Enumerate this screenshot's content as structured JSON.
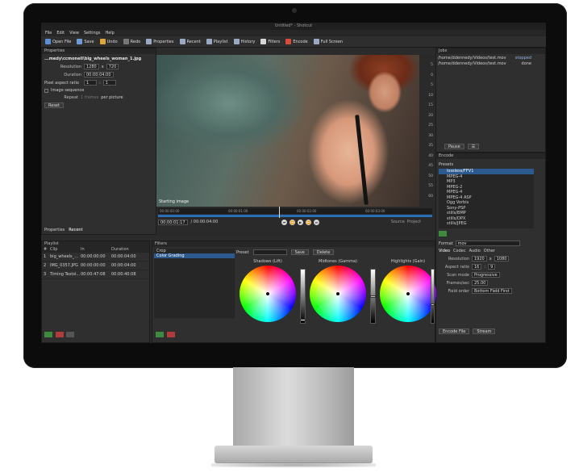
{
  "window": {
    "title": "Untitled* - Shotcut"
  },
  "menu": [
    "File",
    "Edit",
    "View",
    "Settings",
    "Help"
  ],
  "toolbar": [
    {
      "label": "Open File",
      "icon": "open-file-icon",
      "color": "#5a8fd6"
    },
    {
      "label": "Save",
      "icon": "save-icon",
      "color": "#6d9bd8"
    },
    {
      "label": "Undo",
      "icon": "undo-icon",
      "color": "#e0a43a"
    },
    {
      "label": "Redo",
      "icon": "redo-icon",
      "color": "#777777"
    },
    {
      "label": "Properties",
      "icon": "properties-icon",
      "color": "#9aa9c2"
    },
    {
      "label": "Recent",
      "icon": "recent-icon",
      "color": "#9aa9c2"
    },
    {
      "label": "Playlist",
      "icon": "playlist-icon",
      "color": "#9aa9c2"
    },
    {
      "label": "History",
      "icon": "history-icon",
      "color": "#9aa9c2"
    },
    {
      "label": "Filters",
      "icon": "filters-icon",
      "color": "#d7d7d7"
    },
    {
      "label": "Encode",
      "icon": "encode-icon",
      "color": "#d94b3b"
    },
    {
      "label": "Full Screen",
      "icon": "full-screen-icon",
      "color": "#9aa9c2"
    }
  ],
  "properties": {
    "title": "Properties",
    "file": "...medy\\ccmonell\\big_wheels_woman_1.jpg",
    "resolution_label": "Resolution",
    "res_w": "1280",
    "res_x": "x",
    "res_h": "720",
    "duration_label": "Duration",
    "duration": "00:00:04:00",
    "pixel_aspect_label": "Pixel aspect ratio",
    "pa_num": "1",
    "pa_colon": ":",
    "pa_den": "1",
    "image_sequence_label": "Image sequence",
    "repeat_label": "Repeat",
    "repeat_value": "1 frames",
    "per_picture": "per picture",
    "reset": "Reset",
    "tabs": [
      "Properties",
      "Recent"
    ]
  },
  "viewer": {
    "caption": "Starting image"
  },
  "ruler_marks": [
    "5",
    "0",
    "5",
    "10",
    "15",
    "20",
    "25",
    "30",
    "35",
    "40",
    "45",
    "50",
    "55",
    "60"
  ],
  "timeline": {
    "ticks": [
      "00:00:00:00",
      "00:00:01:00",
      "00:00:02:00",
      "00:00:03:00"
    ],
    "current": "00:00:01:17",
    "total": "/ 00:00:04:00",
    "zoom": "",
    "transport": [
      "⏮",
      "⏪",
      "▶",
      "⏩",
      "⏭"
    ],
    "playhead_fraction": 0.44,
    "source_tab": "Source",
    "project_tab": "Project"
  },
  "jobs": {
    "title": "Jobs",
    "rows": [
      {
        "file": "/home/ddennedy/Videos/test.mov",
        "status": "stopped"
      },
      {
        "file": "/home/ddennedy/Videos/test.mov",
        "status": "done"
      }
    ],
    "pause": "Pause",
    "menu": "☰"
  },
  "encode": {
    "title": "Encode",
    "presets_label": "Presets",
    "presets": [
      "lossless/FFV1",
      "MPEG-4",
      "MP3",
      "MPEG-2",
      "MPEG-4",
      "MPEG-4 ASP",
      "Ogg Vorbis",
      "Sony-PSP",
      "stills/BMP",
      "stills/DPX",
      "stills/JPEG"
    ],
    "format_label": "Format",
    "format_value": "mov",
    "tabs": [
      "Video",
      "Codec",
      "Audio",
      "Other"
    ],
    "resolution_label": "Resolution",
    "res_w": "1920",
    "res_x": "x",
    "res_h": "1080",
    "aspect_label": "Aspect ratio",
    "aspect_w": "16",
    "aspect_colon": ":",
    "aspect_h": "9",
    "scan_label": "Scan mode",
    "scan_value": "Progressive",
    "fps_label": "Frames/sec",
    "fps_value": "25.00",
    "field_label": "Field order",
    "field_value": "Bottom Field First",
    "encode_btn": "Encode File",
    "stream_btn": "Stream"
  },
  "playlist": {
    "title": "Playlist",
    "columns": [
      "#",
      "Clip",
      "In",
      "Duration"
    ],
    "rows": [
      {
        "n": "1",
        "clip": "big_wheels_...",
        "in": "00:00:00:00",
        "dur": "00:00:04:00"
      },
      {
        "n": "2",
        "clip": "IMG_0357.JPG",
        "in": "00:00:00:00",
        "dur": "00:00:04:00"
      },
      {
        "n": "3",
        "clip": "Timing Testsl...",
        "in": "00:00:47:08",
        "dur": "00:00:40:08"
      }
    ]
  },
  "filters": {
    "title": "Filters",
    "items": [
      "Crop",
      "Color Grading"
    ],
    "preset_label": "Preset",
    "save": "Save",
    "delete": "Delete",
    "wheels": [
      {
        "label": "Shadows (Lift)",
        "knob": 0.96
      },
      {
        "label": "Midtones (Gamma)",
        "knob": 0.5
      },
      {
        "label": "Highlights (Gain)",
        "knob": 0.66
      }
    ]
  }
}
